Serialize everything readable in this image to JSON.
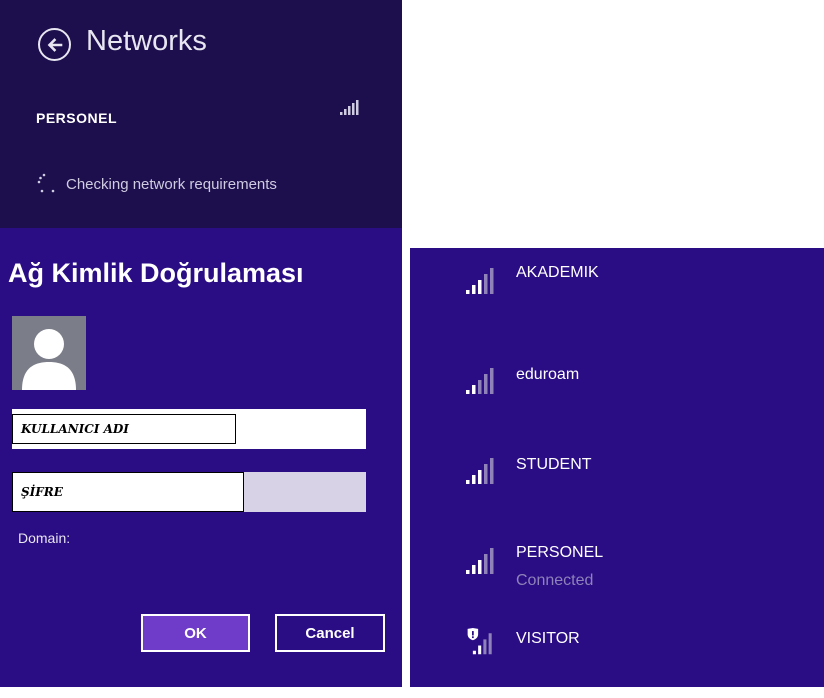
{
  "colors": {
    "header_bg": "#1d0f4d",
    "dialog_bg": "#2a0c85",
    "ok_button_bg": "#6f3cc9",
    "connected_text": "#8e82b8"
  },
  "header": {
    "back_icon": "back-arrow-circle-icon",
    "title": "Networks",
    "current_network": "PERSONEL",
    "signal_icon": "wifi-signal-icon",
    "status": "Checking network requirements"
  },
  "auth": {
    "title": "Ağ Kimlik Doğrulaması",
    "avatar_icon": "user-avatar-icon",
    "username_label": "KULLANICI ADI",
    "password_label": "ŞİFRE",
    "domain_label": "Domain:",
    "ok_label": "OK",
    "cancel_label": "Cancel"
  },
  "networks": [
    {
      "ssid": "AKADEMIK",
      "state": "",
      "icon": "wifi-signal-icon"
    },
    {
      "ssid": "eduroam",
      "state": "",
      "icon": "wifi-signal-icon"
    },
    {
      "ssid": "STUDENT",
      "state": "",
      "icon": "wifi-signal-icon"
    },
    {
      "ssid": "PERSONEL",
      "state": "Connected",
      "icon": "wifi-signal-icon"
    },
    {
      "ssid": "VISITOR",
      "state": "",
      "icon": "wifi-signal-shield-icon"
    }
  ]
}
